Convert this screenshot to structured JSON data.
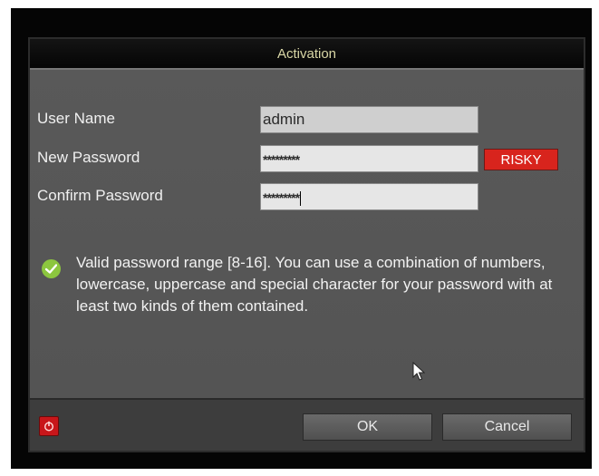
{
  "dialog": {
    "title": "Activation"
  },
  "form": {
    "username_label": "User Name",
    "username_value": "admin",
    "new_password_label": "New Password",
    "new_password_value": "*********",
    "confirm_password_label": "Confirm Password",
    "confirm_password_value": "*********",
    "strength_badge": "RISKY"
  },
  "hint": {
    "text": "Valid password range [8-16]. You can use a combination of numbers, lowercase, uppercase and special character for your password with at least two kinds of them contained."
  },
  "footer": {
    "ok_label": "OK",
    "cancel_label": "Cancel"
  },
  "icons": {
    "check": "check-icon",
    "power": "power-icon",
    "pointer": "mouse-pointer-icon"
  },
  "colors": {
    "title_text": "#d9d7a6",
    "badge_red": "#d8241d",
    "check_green": "#8cc63f",
    "power_red": "#c8161a"
  }
}
